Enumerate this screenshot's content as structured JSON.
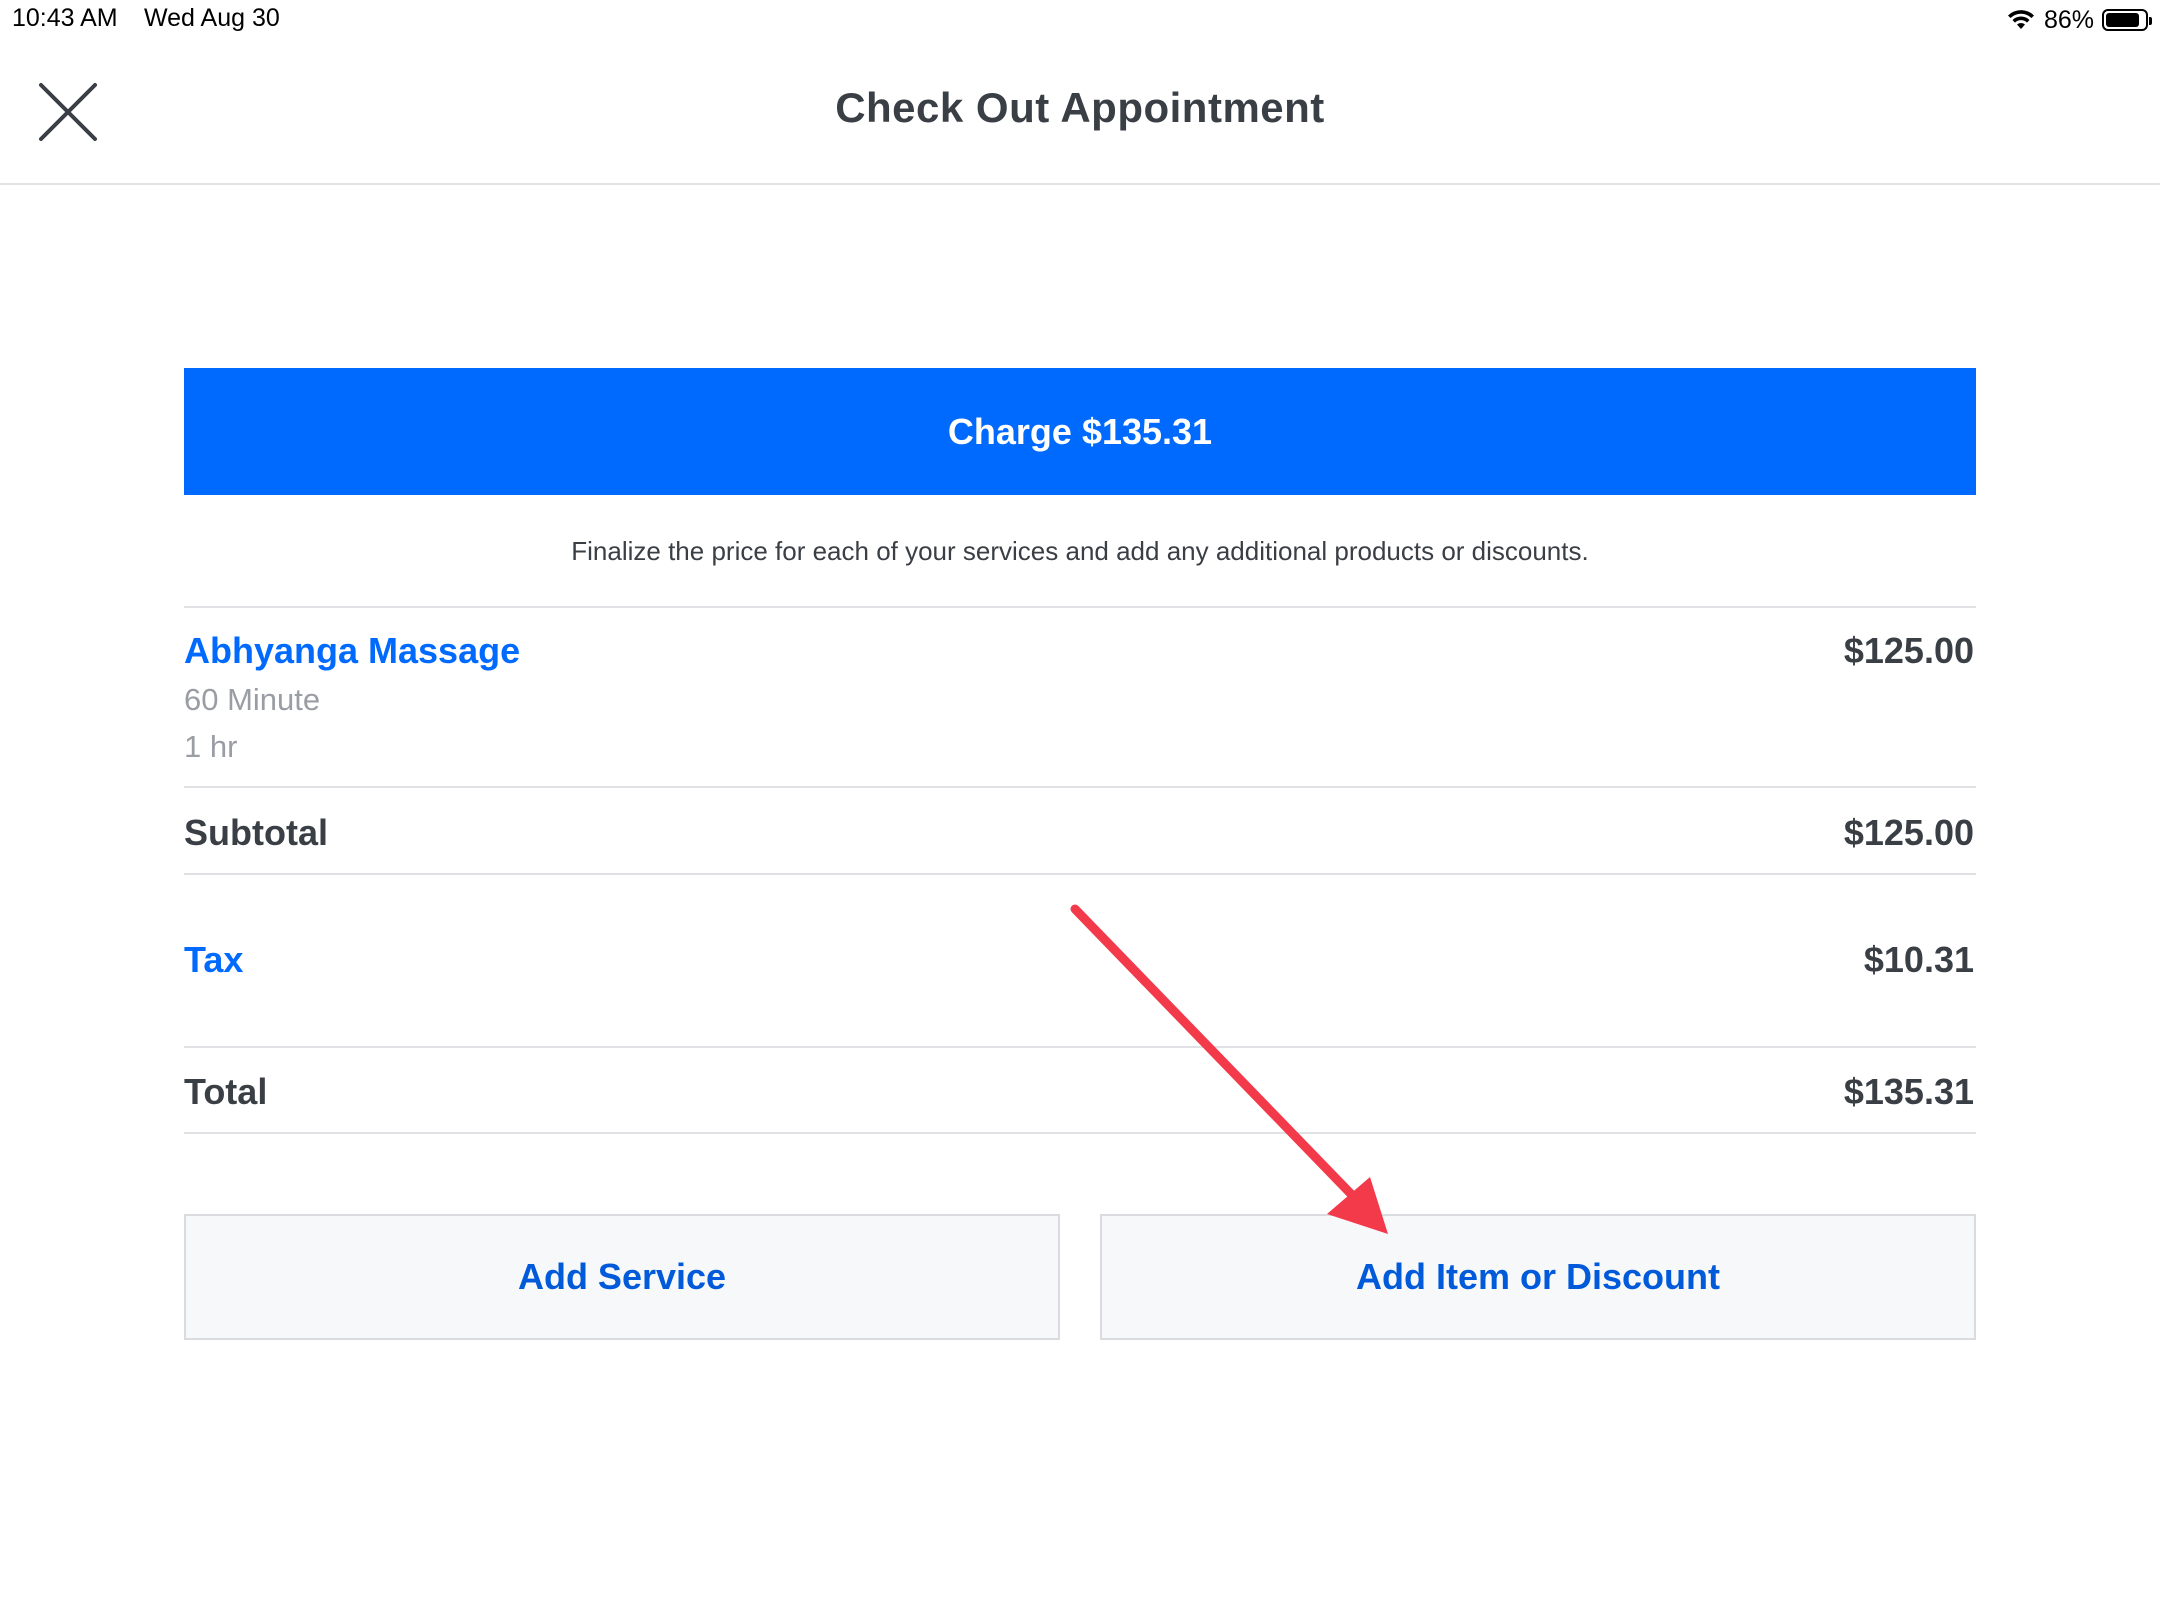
{
  "status_bar": {
    "time": "10:43 AM",
    "date": "Wed Aug 30",
    "battery_percent_label": "86%",
    "battery_level": 0.86,
    "wifi_icon": "wifi-icon",
    "battery_icon": "battery-icon"
  },
  "header": {
    "title": "Check Out Appointment",
    "close_icon": "close-icon"
  },
  "charge": {
    "label": "Charge $135.31"
  },
  "instructions": "Finalize the price for each of your services and add any additional products or discounts.",
  "service": {
    "name": "Abhyanga Massage",
    "variant": "60 Minute",
    "duration": "1 hr",
    "price": "$125.00"
  },
  "summary": {
    "subtotal_label": "Subtotal",
    "subtotal_value": "$125.00",
    "tax_label": "Tax",
    "tax_value": "$10.31",
    "total_label": "Total",
    "total_value": "$135.31"
  },
  "actions": {
    "add_service": "Add Service",
    "add_item_or_discount": "Add Item or Discount"
  },
  "colors": {
    "accent": "#006aff",
    "link": "#005ad9",
    "text": "#3a3f45",
    "muted": "#9a9ea4",
    "annotation_arrow": "#f23a4a"
  }
}
